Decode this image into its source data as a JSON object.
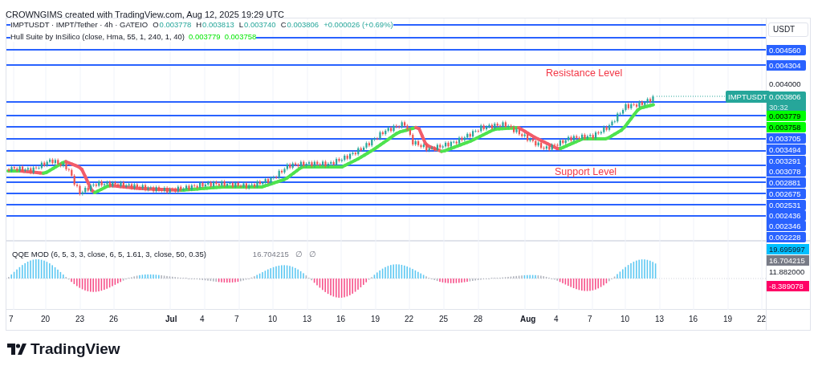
{
  "header": {
    "credit": "CROWNGIMS created with TradingView.com, Aug 12, 2025 19:29 UTC"
  },
  "legend": {
    "symbol": "IMPTUSDT · IMPT/Tether · 4h · GATEIO",
    "ohlc": [
      {
        "key": "O",
        "value": "0.003778"
      },
      {
        "key": "H",
        "value": "0.003813"
      },
      {
        "key": "L",
        "value": "0.003740"
      },
      {
        "key": "C",
        "value": "0.003806"
      }
    ],
    "change": "+0.000026 (+0.69%)"
  },
  "hull": {
    "label": "Hull Suite by InSilico (close, Hma, 55, 1, 240, 1, 40)",
    "values": [
      "0.003779",
      "0.003758"
    ]
  },
  "annotations": [
    {
      "kind": "resistance",
      "text": "Resistance Level"
    },
    {
      "kind": "support",
      "text": "Support Level"
    }
  ],
  "symbol_tag": "IMPTUSDT",
  "price_axis": {
    "currency": "USDT",
    "labels": [
      {
        "kind": "line",
        "text": "0.004560"
      },
      {
        "kind": "line",
        "text": "0.004304"
      },
      {
        "kind": "plain",
        "text": "0.004000"
      },
      {
        "kind": "last",
        "text": "0.003806",
        "countdown": "30:32"
      },
      {
        "kind": "hull",
        "text": "0.003779"
      },
      {
        "kind": "hull",
        "text": "0.003758"
      },
      {
        "kind": "line",
        "text": "0.003705"
      },
      {
        "kind": "line",
        "text": "0.003494"
      },
      {
        "kind": "line",
        "text": "0.003291"
      },
      {
        "kind": "line",
        "text": "0.003078"
      },
      {
        "kind": "line",
        "text": "0.002881"
      },
      {
        "kind": "line",
        "text": "0.002675"
      },
      {
        "kind": "line",
        "text": "0.002531"
      },
      {
        "kind": "line",
        "text": "0.002436"
      },
      {
        "kind": "line",
        "text": "0.002346"
      },
      {
        "kind": "line",
        "text": "0.002228"
      }
    ]
  },
  "qqe": {
    "label": "QQE MOD (6, 5, 3, 3, close, 6, 5, 1.61, 3, close, 50, 0.35)",
    "value": "16.704215",
    "icons": [
      "∅",
      "∅"
    ]
  },
  "qqe_axis": [
    {
      "kind": "upper",
      "text": "19.695997"
    },
    {
      "kind": "value",
      "text": "16.704215"
    },
    {
      "kind": "plain",
      "text": "11.882000"
    },
    {
      "kind": "lower",
      "text": "-8.389078"
    }
  ],
  "time_axis": [
    {
      "label": "7",
      "month": false
    },
    {
      "label": "20",
      "month": false
    },
    {
      "label": "23",
      "month": false
    },
    {
      "label": "26",
      "month": false
    },
    {
      "label": "Jul",
      "month": true
    },
    {
      "label": "4",
      "month": false
    },
    {
      "label": "7",
      "month": false
    },
    {
      "label": "10",
      "month": false
    },
    {
      "label": "13",
      "month": false
    },
    {
      "label": "16",
      "month": false
    },
    {
      "label": "19",
      "month": false
    },
    {
      "label": "22",
      "month": false
    },
    {
      "label": "25",
      "month": false
    },
    {
      "label": "28",
      "month": false
    },
    {
      "label": "Aug",
      "month": true
    },
    {
      "label": "4",
      "month": false
    },
    {
      "label": "7",
      "month": false
    },
    {
      "label": "10",
      "month": false
    },
    {
      "label": "13",
      "month": false
    },
    {
      "label": "16",
      "month": false
    },
    {
      "label": "19",
      "month": false
    },
    {
      "label": "22",
      "month": false
    }
  ],
  "logo": {
    "text": "TradingView"
  }
}
